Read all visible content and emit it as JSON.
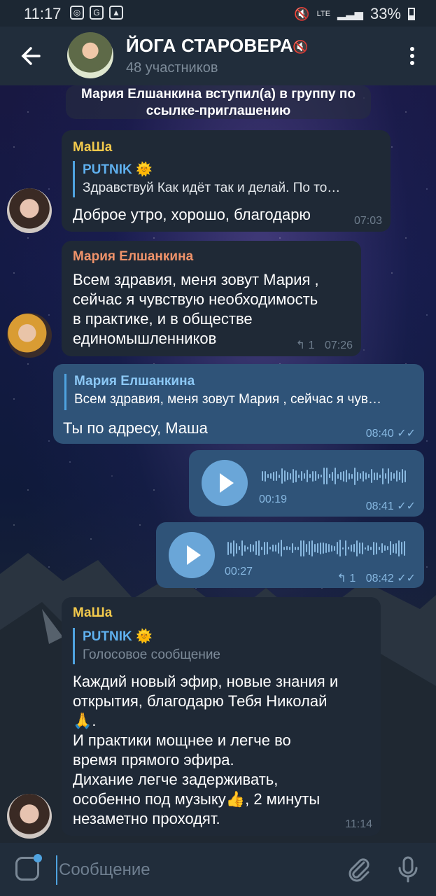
{
  "status_bar": {
    "time": "11:17",
    "network": "LTE",
    "battery": "33%"
  },
  "header": {
    "title": "ЙОГА СТАРОВЕРА",
    "subtitle": "48 участников"
  },
  "service_message": {
    "line1": "Мария Елшанкина вступил(а) в группу по",
    "line2": "ссылке-приглашению"
  },
  "messages": [
    {
      "sender": "МаШа",
      "sender_color": "#f2c94c",
      "reply_name": "PUTNIK",
      "reply_text": "Здравствуй   Как идёт так и делай. По то…",
      "text": "Доброе утро, хорошо, благодарю",
      "time": "07:03"
    },
    {
      "sender": "Мария Елшанкина",
      "sender_color": "#f0936a",
      "lines": [
        "Всем здравия, меня зовут Мария ,",
        "сейчас я чувствую необходимость",
        "в практике, и в обществе",
        "единомышленников"
      ],
      "replies": "1",
      "time": "07:26"
    },
    {
      "reply_name": "Мария Елшанкина",
      "reply_text": "Всем здравия, меня зовут Мария , сейчас я чув…",
      "text": "Ты по адресу, Маша",
      "time": "08:40"
    },
    {
      "duration": "00:19",
      "time": "08:41"
    },
    {
      "duration": "00:27",
      "replies": "1",
      "time": "08:42"
    },
    {
      "sender": "МаШа",
      "sender_color": "#f2c94c",
      "reply_name": "PUTNIK",
      "reply_text": "Голосовое сообщение",
      "lines": [
        "Каждий новый эфир, новые знания и",
        "открытия, благодарю Тебя Николай",
        "🙏.",
        "И практики мощнее и легче во",
        "время прямого эфира.",
        "Дихание легче задерживать,",
        "особенно под музыку👍, 2 минуты",
        "незаметно проходят."
      ],
      "time": "11:14"
    }
  ],
  "input": {
    "placeholder": "Сообщение"
  }
}
